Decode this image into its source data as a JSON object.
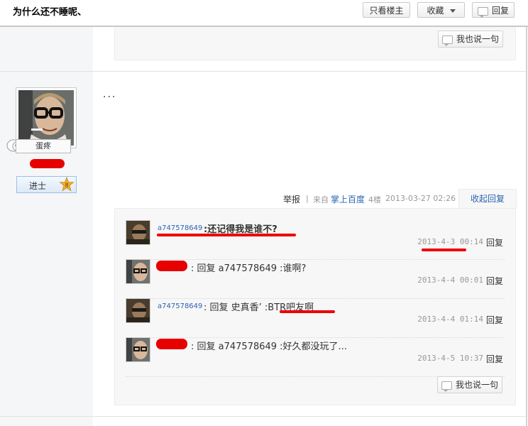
{
  "header": {
    "title": "为什么还不睡呢、",
    "only_author_label": "只看楼主",
    "favorite_label": "收藏",
    "reply_label": "回复"
  },
  "prev_post": {
    "say_label": "我也说一句"
  },
  "author": {
    "nickname": "蛋疼",
    "level_title": "进士",
    "level_num": "8"
  },
  "post": {
    "content": "...",
    "report_label": "举报",
    "source_prefix": "来自",
    "source_name": "掌上百度",
    "floor": "4楼",
    "datetime": "2013-03-27 02:26",
    "collapse_label": "收起回复"
  },
  "replies": [
    {
      "user": "a747578649",
      "text": ":还记得我是谁不?",
      "time": "2013-4-3 00:14",
      "reply_label": "回复"
    },
    {
      "user": "",
      "text": ": 回复 a747578649 :谁啊?",
      "time": "2013-4-4 00:01",
      "reply_label": "回复"
    },
    {
      "user": "a747578649",
      "text": ": 回复 史真香’ :BTR吧友啊",
      "time": "2013-4-4 01:14",
      "reply_label": "回复"
    },
    {
      "user": "",
      "text": ": 回复 a747578649 :好久都没玩了...",
      "time": "2013-4-5 10:37",
      "reply_label": "回复"
    }
  ],
  "reply_box": {
    "say_label": "我也说一句"
  },
  "colors": {
    "link": "#2d64b3",
    "annotation_red": "#e00000",
    "level_star": "#f0b030"
  }
}
